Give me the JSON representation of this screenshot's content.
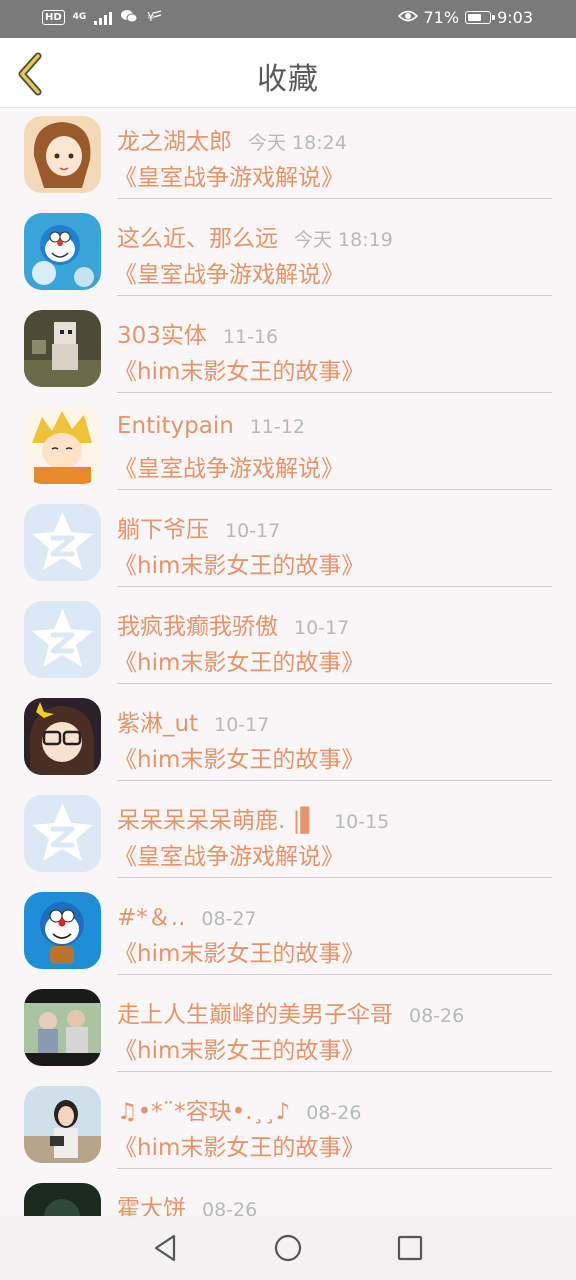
{
  "status_bar": {
    "hd": "HD",
    "network": "4G",
    "battery_percent_text": "71%",
    "battery_level": 0.71,
    "time": "9:03",
    "icons": [
      "signal-icon",
      "wechat-icon",
      "payment-icon",
      "eye-icon",
      "battery-icon"
    ]
  },
  "header": {
    "title": "收藏",
    "back_icon": "chevron-left-icon"
  },
  "colors": {
    "accent": "#e8946a",
    "date": "#b8b8b8",
    "title_text": "#5a5a5a",
    "back_chevron": "#e8c94a"
  },
  "favorites": [
    {
      "name": "龙之湖太郎",
      "date": "今天 18:24",
      "title": "《皇室战争游戏解说》",
      "avatar": "anime-girl-avatar"
    },
    {
      "name": "这么近、那么远",
      "date": "今天 18:19",
      "title": "《皇室战争游戏解说》",
      "avatar": "doraemon-avatar"
    },
    {
      "name": "303实体",
      "date": "11-16",
      "title": "《him末影女王的故事》",
      "avatar": "minecraft-avatar"
    },
    {
      "name": "Entitypain",
      "date": "11-12",
      "title": "《皇室战争游戏解说》",
      "avatar": "anime-blonde-avatar"
    },
    {
      "name": "躺下爷压",
      "date": "10-17",
      "title": "《him末影女王的故事》",
      "avatar": "default-star-avatar"
    },
    {
      "name": "我疯我癫我骄傲",
      "date": "10-17",
      "title": "《him末影女王的故事》",
      "avatar": "default-star-avatar"
    },
    {
      "name": "紫淋_ut",
      "date": "10-17",
      "title": "《him末影女王的故事》",
      "avatar": "anime-glasses-avatar"
    },
    {
      "name": "呆呆呆呆呆萌鹿. |▌",
      "date": "10-15",
      "title": "《皇室战争游戏解说》",
      "avatar": "default-star-avatar"
    },
    {
      "name": "#*＆..",
      "date": "08-27",
      "title": "《him末影女王的故事》",
      "avatar": "doraemon-blue-avatar"
    },
    {
      "name": "走上人生巅峰的美男子伞哥",
      "date": "08-26",
      "title": "《him末影女王的故事》",
      "avatar": "photo-avatar"
    },
    {
      "name": "♫•*¨*容玦•.¸¸♪",
      "date": "08-26",
      "title": "《him末影女王的故事》",
      "avatar": "girl-photo-avatar"
    },
    {
      "name": "霍大饼",
      "date": "08-26",
      "title": "",
      "avatar": "dark-avatar"
    }
  ],
  "nav_bar": {
    "icons": [
      "back-triangle-icon",
      "home-circle-icon",
      "recents-square-icon"
    ]
  }
}
